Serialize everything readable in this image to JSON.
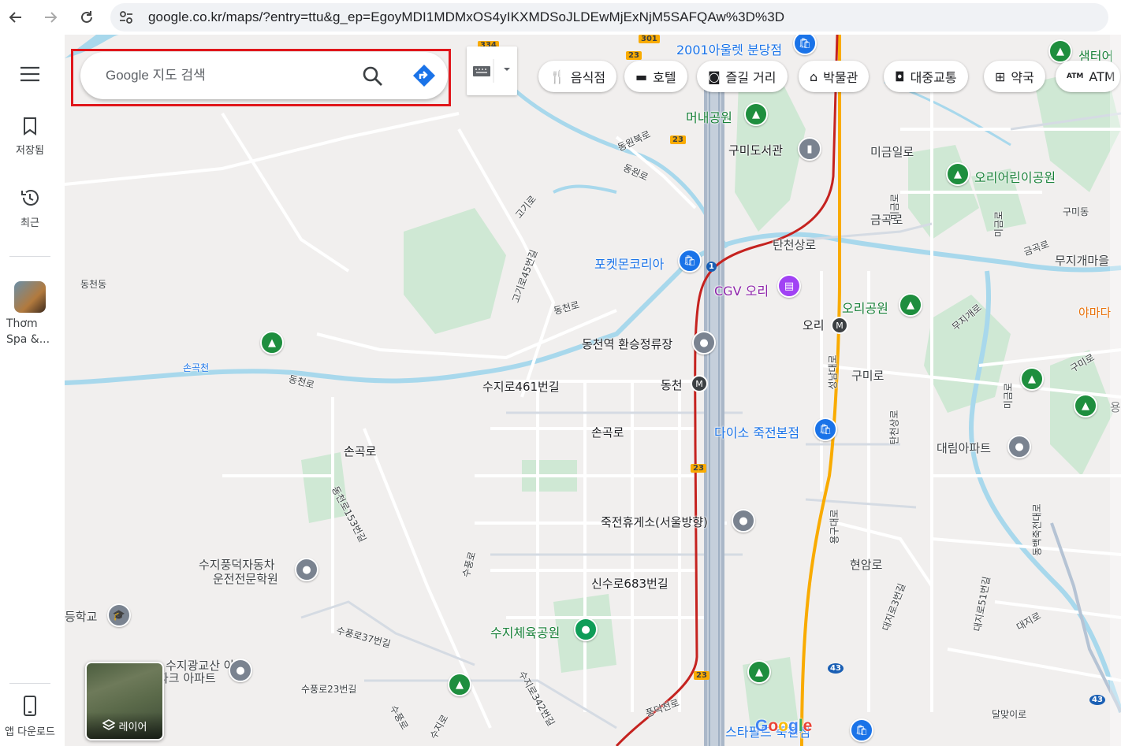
{
  "browser": {
    "url": "google.co.kr/maps/?entry=ttu&g_ep=EgoyMDI1MDMxOS4yIKXMDSoJLDEwMjExNjM5SAFQAw%3D%3D",
    "back_icon": "arrow-left-icon",
    "forward_icon": "arrow-right-icon",
    "reload_icon": "reload-icon"
  },
  "rail": {
    "menu_icon": "hamburger-menu-icon",
    "saved_label": "저장됨",
    "recent_label": "최근",
    "recent_place_label": "Thơm Spa &...",
    "download_label": "앱 다운로드"
  },
  "search": {
    "placeholder": "Google 지도 검색"
  },
  "chips": [
    {
      "label": "음식점",
      "icon": "fork-knife-icon"
    },
    {
      "label": "호텔",
      "icon": "bed-icon"
    },
    {
      "label": "즐길 거리",
      "icon": "camera-icon"
    },
    {
      "label": "박물관",
      "icon": "museum-icon"
    },
    {
      "label": "대중교통",
      "icon": "train-icon"
    },
    {
      "label": "약국",
      "icon": "pharmacy-icon"
    },
    {
      "label": "ATM",
      "icon": "atm-icon",
      "icon_text": "ATM"
    }
  ],
  "layers_label": "레이어",
  "map_labels": {
    "l1": "2001아울렛 분당점",
    "l2": "샘터어",
    "l3": "머내공원",
    "l4": "동원북로",
    "l5": "구미도서관",
    "l6": "미금일로",
    "l7": "동원로",
    "l8": "오리어린이공원",
    "l9": "고기로",
    "l10": "구미동",
    "l11": "금곡로",
    "l12": "미금로",
    "l13": "탄천상로",
    "l14": "금곡로",
    "l15": "무지개마을",
    "l16": "포켓몬코리아",
    "l17": "고기로45번길",
    "l18": "동천동",
    "l19": "CGV 오리",
    "l20": "야마다",
    "l21": "동천로",
    "l22": "오리공원",
    "l23": "무지개로",
    "l24": "오리",
    "l25": "동천역 환승정류장",
    "l26": "손곡천",
    "l27": "동천로",
    "l28": "수지로461번길",
    "l29": "동천",
    "l30": "구미로",
    "l31": "구미로",
    "l32": "성남대로",
    "l33": "탄천상로",
    "l34": "손곡로",
    "l35": "다이소 죽전본점",
    "l36": "손곡로",
    "l37": "대림아파트",
    "l38": "동천로153번길",
    "l39": "죽전휴게소(서울방향)",
    "l40": "용구대로",
    "l41": "동백죽전대로",
    "l42": "수지풍덕자동차",
    "l43": "운전전문학원",
    "l44": "수풍로",
    "l45": "신수로683번길",
    "l46": "현암로",
    "l47": "등학교",
    "l48": "수풍로37번길",
    "l49": "수지체육공원",
    "l50": "대지로3번길",
    "l51": "대지로51번길",
    "l52": "대지로",
    "l53": "수지광교산 아이",
    "l54": "파크 아파트",
    "l55": "수풍로23번길",
    "l56": "수지로342번길",
    "l57": "풍덕천로",
    "l58": "수지로",
    "l59": "수풍로",
    "l60": "스타필드 죽전점",
    "l61": "달맞이로",
    "l62": "미금로",
    "l63": "미금로",
    "l64": "용"
  },
  "shields": {
    "s1": "334",
    "s2": "23",
    "s3": "23",
    "s4": "1",
    "s5": "23",
    "s6": "23",
    "s7": "43",
    "s8": "43",
    "s9": "301"
  },
  "google_logo": "Google",
  "colors": {
    "highlight_red": "#e0161b",
    "rail_red": "#c5221f",
    "expressway_yellow": "#f9ab00"
  }
}
